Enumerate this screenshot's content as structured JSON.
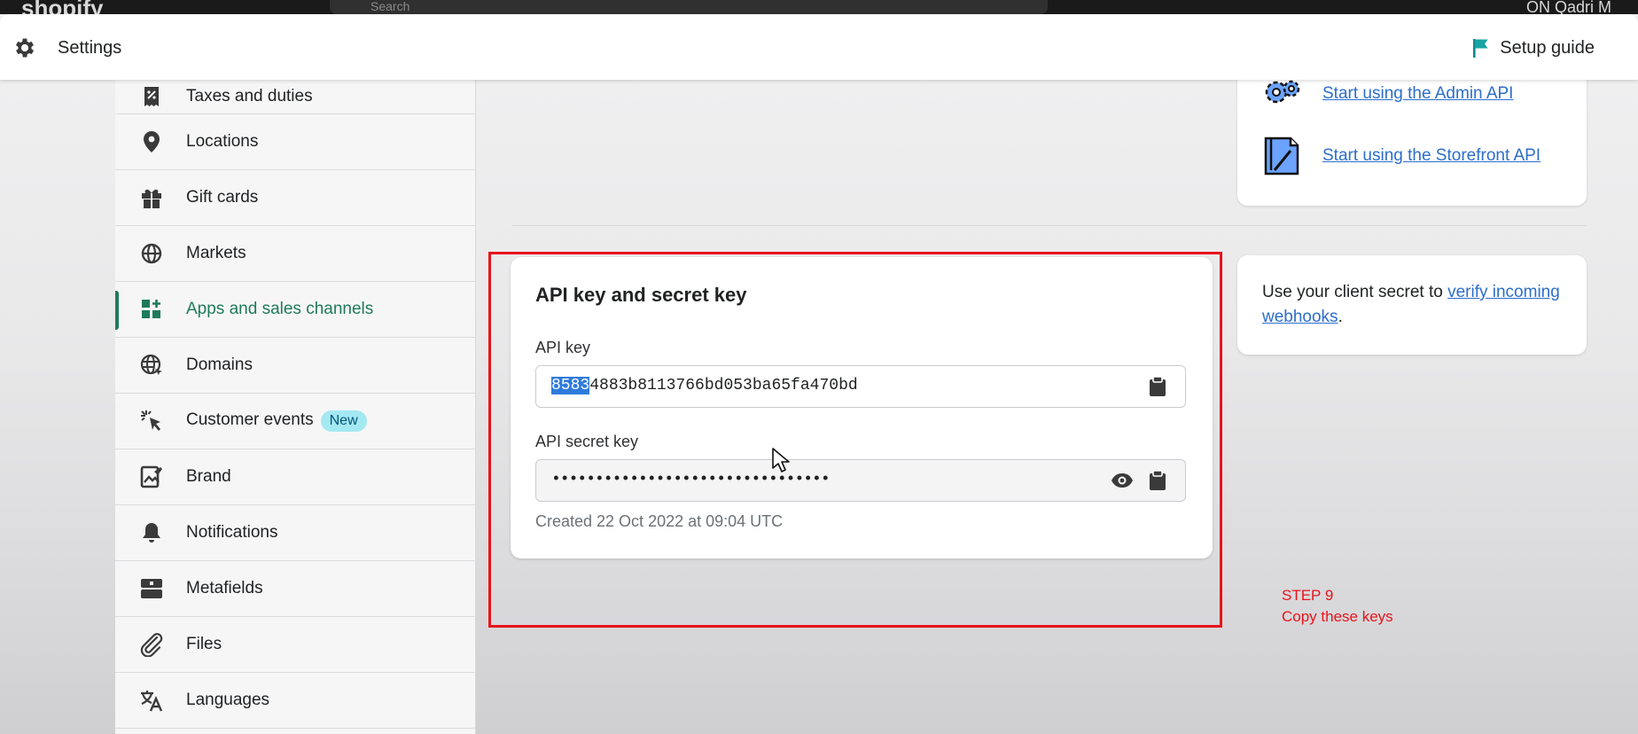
{
  "admin_bar": {
    "logo": "shopify",
    "search_placeholder": "Search",
    "user": "ON Qadri M"
  },
  "header": {
    "title": "Settings",
    "setup_guide": "Setup guide"
  },
  "sidebar": {
    "items": [
      {
        "label": "Taxes and duties",
        "icon": "taxes-icon"
      },
      {
        "label": "Locations",
        "icon": "location-pin-icon"
      },
      {
        "label": "Gift cards",
        "icon": "gift-icon"
      },
      {
        "label": "Markets",
        "icon": "globe-icon"
      },
      {
        "label": "Apps and sales channels",
        "icon": "apps-icon",
        "active": true
      },
      {
        "label": "Domains",
        "icon": "domains-globe-icon"
      },
      {
        "label": "Customer events",
        "icon": "cursor-click-icon",
        "badge": "New"
      },
      {
        "label": "Brand",
        "icon": "brand-icon"
      },
      {
        "label": "Notifications",
        "icon": "bell-icon"
      },
      {
        "label": "Metafields",
        "icon": "metafields-icon"
      },
      {
        "label": "Files",
        "icon": "paperclip-icon"
      },
      {
        "label": "Languages",
        "icon": "translate-icon"
      }
    ]
  },
  "resources": {
    "admin_api": "Start using the Admin API",
    "storefront_api": "Start using the Storefront API"
  },
  "api_card": {
    "title": "API key and secret key",
    "api_key_label": "API key",
    "api_key_selected": "8583",
    "api_key_rest": "4883b8113766bd053ba65fa470bd",
    "secret_label": "API secret key",
    "secret_masked": "••••••••••••••••••••••••••••••••",
    "created": "Created 22 Oct 2022 at 09:04 UTC"
  },
  "verify_card": {
    "text_before": "Use your client secret to ",
    "link": "verify incoming webhooks",
    "text_after": "."
  },
  "annotation": {
    "line1": "STEP 9",
    "line2": "Copy these keys"
  },
  "colors": {
    "accent": "#1f7a5b",
    "link": "#2c6ecb",
    "highlight": "#e8131b",
    "selection": "#2f7bdc",
    "badge_bg": "#a4e8f2"
  }
}
